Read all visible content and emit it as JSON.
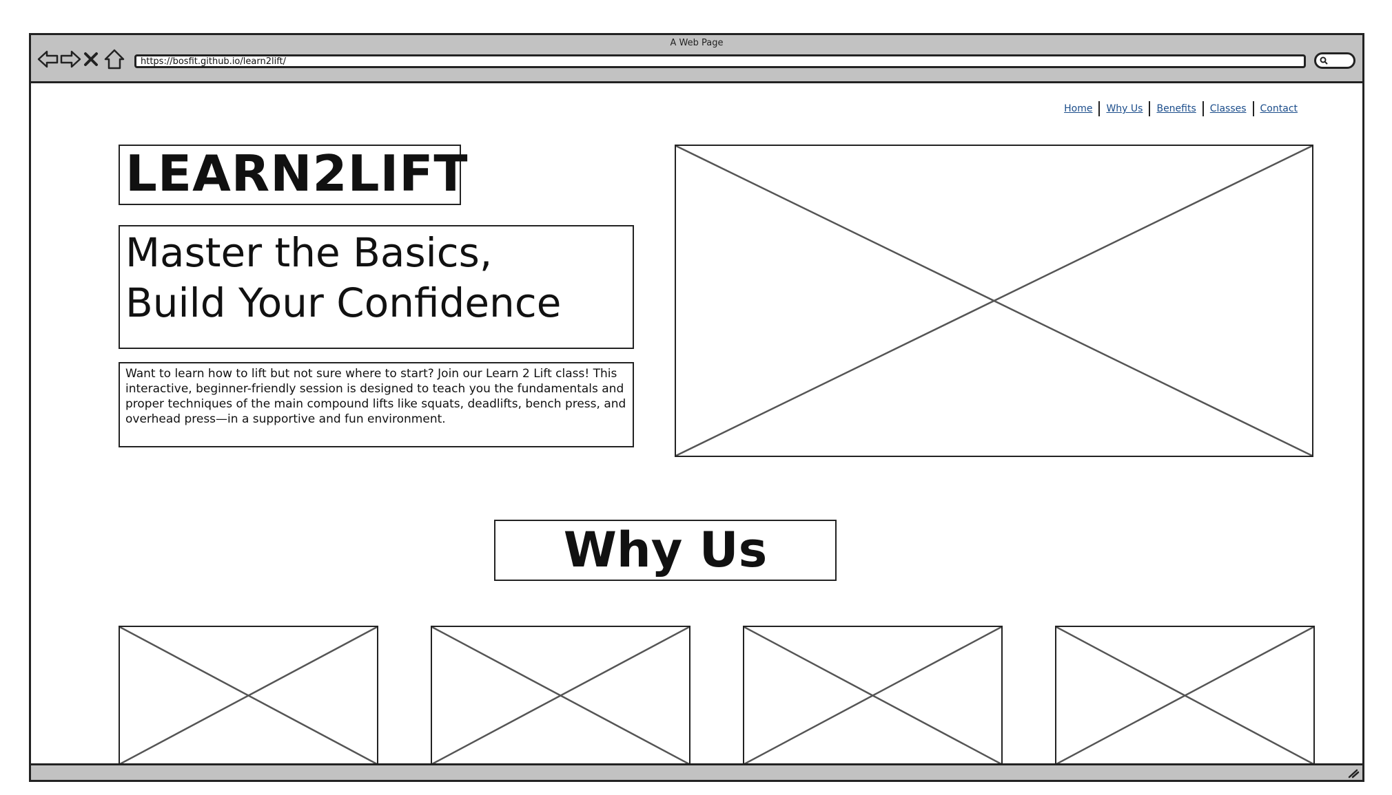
{
  "browser": {
    "title": "A Web Page",
    "url": "https://bosfit.github.io/learn2lift/"
  },
  "nav": {
    "items": [
      {
        "label": "Home"
      },
      {
        "label": "Why Us"
      },
      {
        "label": "Benefits"
      },
      {
        "label": "Classes"
      },
      {
        "label": "Contact"
      }
    ]
  },
  "hero": {
    "logo": "LEARN2LIFT",
    "headline_line1": "Master the Basics,",
    "headline_line2": "Build Your Confidence",
    "description": "Want to learn how to lift but not sure where to start? Join our Learn 2 Lift class! This interactive, beginner-friendly session is designed to teach you the fundamentals and proper techniques of the main compound lifts like squats, deadlifts, bench press, and overhead press—in a supportive and fun environment."
  },
  "why_us": {
    "heading": "Why Us"
  },
  "colors": {
    "chrome": "#c2c2c2",
    "link": "#1a4c8a",
    "stroke": "#222222"
  },
  "icons": [
    "back-arrow-icon",
    "forward-arrow-icon",
    "stop-icon",
    "home-icon",
    "search-icon",
    "resize-grip-icon"
  ]
}
